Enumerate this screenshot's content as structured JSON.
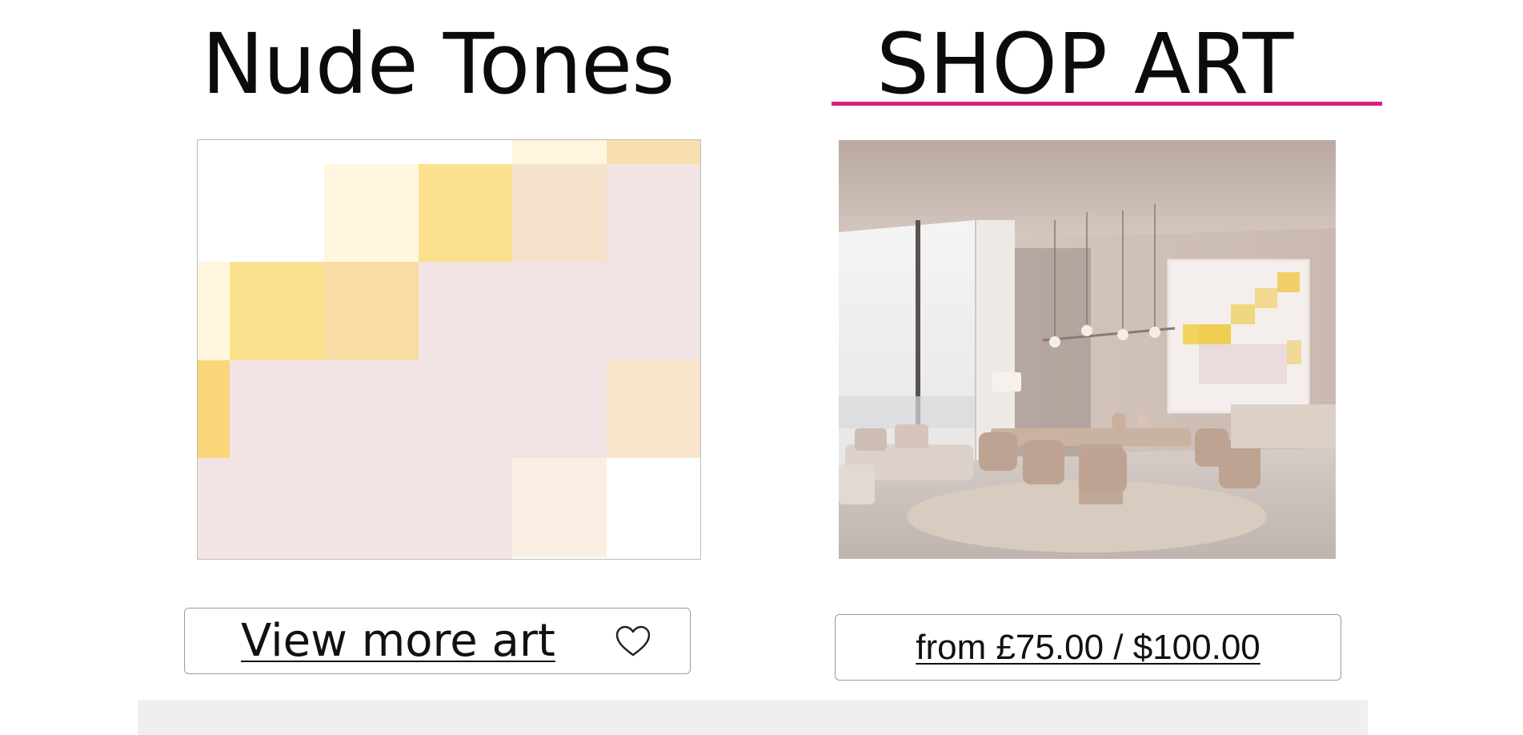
{
  "collection": {
    "title": "Nude Tones",
    "view_more_label": "View more art",
    "favorite_icon": "heart-outline-icon"
  },
  "shop": {
    "title": "SHOP ART",
    "price_label": "from £75.00 / $100.00",
    "accent_color": "#d8207d"
  },
  "artwork": {
    "palette": {
      "white": "#ffffff",
      "cream": "#fff6dd",
      "butter": "#fbe08e",
      "sand": "#f7dca4",
      "yellow": "#fbd679",
      "blush": "#f2e4e4",
      "peach": "#f7e4cb",
      "shell": "#fbefe4"
    }
  }
}
